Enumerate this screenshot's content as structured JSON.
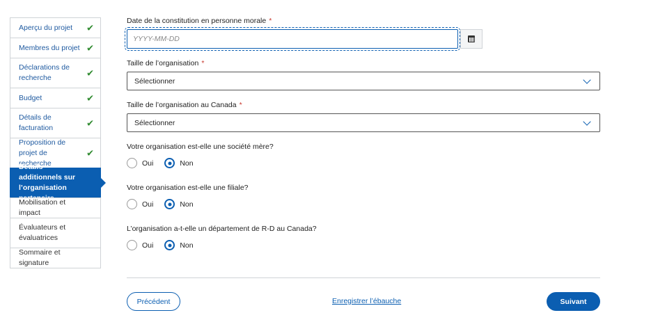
{
  "sidebar": {
    "items": [
      {
        "label": "Aperçu du projet",
        "state": "done"
      },
      {
        "label": "Membres du projet",
        "state": "done"
      },
      {
        "label": "Déclarations de recherche",
        "state": "done"
      },
      {
        "label": "Budget",
        "state": "done"
      },
      {
        "label": "Détails de facturation",
        "state": "done"
      },
      {
        "label": "Proposition de projet de recherche",
        "state": "done"
      },
      {
        "label": "Détails additionnels sur l’organisation partenaire",
        "state": "active"
      },
      {
        "label": "Mobilisation et impact",
        "state": "todo"
      },
      {
        "label": "Évaluateurs et évaluatrices",
        "state": "todo"
      },
      {
        "label": "Sommaire et signature",
        "state": "todo"
      }
    ],
    "check_glyph": "✔"
  },
  "form": {
    "date_label": "Date de la constitution en personne morale",
    "date_placeholder": "YYYY-MM-DD",
    "required_mark": "*",
    "size_label": "Taille de l’organisation",
    "size_value": "Sélectionner",
    "size_canada_label": "Taille de l’organisation au Canada",
    "size_canada_value": "Sélectionner",
    "q1": "Votre organisation est-elle une société mère?",
    "q2": "Votre organisation est-elle une filiale?",
    "q3": "L’organisation a-t-elle un département de R-D au Canada?",
    "opt_yes": "Oui",
    "opt_no": "Non",
    "selected": [
      "Non",
      "Non",
      "Non"
    ]
  },
  "footer": {
    "prev_label": "Précédent",
    "draft_label": "Enregistrer l’ébauche",
    "next_label": "Suivant"
  },
  "colors": {
    "primary": "#0b5eb1",
    "check": "#2f8a2f",
    "required": "#c8372d"
  }
}
